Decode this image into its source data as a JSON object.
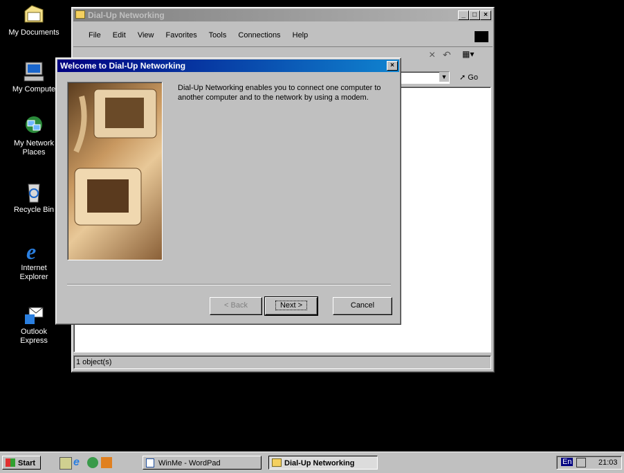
{
  "desktop": {
    "icons": [
      {
        "label": "My Documents"
      },
      {
        "label": "My Compute"
      },
      {
        "label": "My Network Places"
      },
      {
        "label": "Recycle Bin"
      },
      {
        "label": "Internet Explorer"
      },
      {
        "label": "Outlook Express"
      }
    ]
  },
  "explorer": {
    "title": "Dial-Up Networking",
    "menu": [
      "File",
      "Edit",
      "View",
      "Favorites",
      "Tools",
      "Connections",
      "Help"
    ],
    "go_label": "Go",
    "status": "1 object(s)"
  },
  "wizard": {
    "title": "Welcome to Dial-Up Networking",
    "text": "Dial-Up Networking enables you to connect one computer to another computer and to the network by using a modem.",
    "back_label": "< Back",
    "next_label": "Next >",
    "cancel_label": "Cancel"
  },
  "taskbar": {
    "start_label": "Start",
    "tasks": [
      {
        "label": "WinMe - WordPad"
      },
      {
        "label": "Dial-Up Networking"
      }
    ],
    "lang": "En",
    "clock": "21:03"
  },
  "colors": {
    "active_title": "#000080",
    "face": "#c0c0c0",
    "desktop": "#000000"
  }
}
